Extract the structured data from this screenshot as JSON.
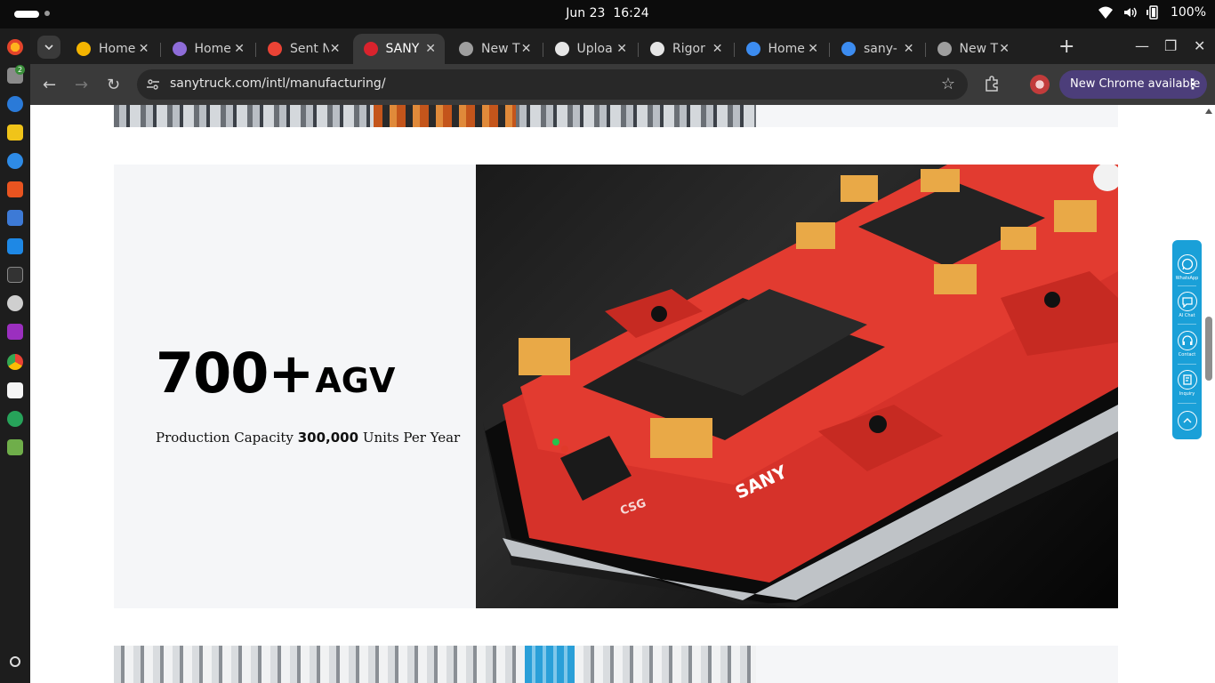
{
  "system": {
    "date": "Jun 23",
    "time": "16:24",
    "battery": "100%"
  },
  "dock": {
    "badge_count": "2"
  },
  "tabs": [
    {
      "title": "Home",
      "color": "#f4b400"
    },
    {
      "title": "Home",
      "color": "#8e6cd8"
    },
    {
      "title": "Sent N",
      "color": "#ea4335"
    },
    {
      "title": "SANY",
      "color": "#d9232d",
      "active": true
    },
    {
      "title": "New T",
      "color": "#9e9e9e"
    },
    {
      "title": "Uploa",
      "color": "#e6e6e6"
    },
    {
      "title": "Rigor",
      "color": "#e6e6e6"
    },
    {
      "title": "Home",
      "color": "#3c8cf0"
    },
    {
      "title": "sany-",
      "color": "#3c8cf0"
    },
    {
      "title": "New T",
      "color": "#9e9e9e"
    }
  ],
  "toolbar": {
    "url": "sanytruck.com/intl/manufacturing/",
    "update_label": "New Chrome available"
  },
  "page": {
    "stat_number": "700+",
    "stat_unit": "AGV",
    "capacity_prefix": "Production Capacity",
    "capacity_value": "300,000",
    "capacity_suffix": "Units Per Year",
    "agv_brand": "SANY",
    "agv_mark": "CSG"
  },
  "side_widget": {
    "items": [
      {
        "label": "WhatsApp",
        "icon": "whatsapp-icon"
      },
      {
        "label": "AI Chat",
        "icon": "chat-icon"
      },
      {
        "label": "Contact",
        "icon": "headset-icon"
      },
      {
        "label": "Inquiry",
        "icon": "inquiry-icon"
      },
      {
        "label": "",
        "icon": "chevron-up-icon"
      }
    ]
  },
  "colors": {
    "accent": "#1aa0d8",
    "brand_red": "#d9232d",
    "update_pill": "#4c3e7a"
  }
}
